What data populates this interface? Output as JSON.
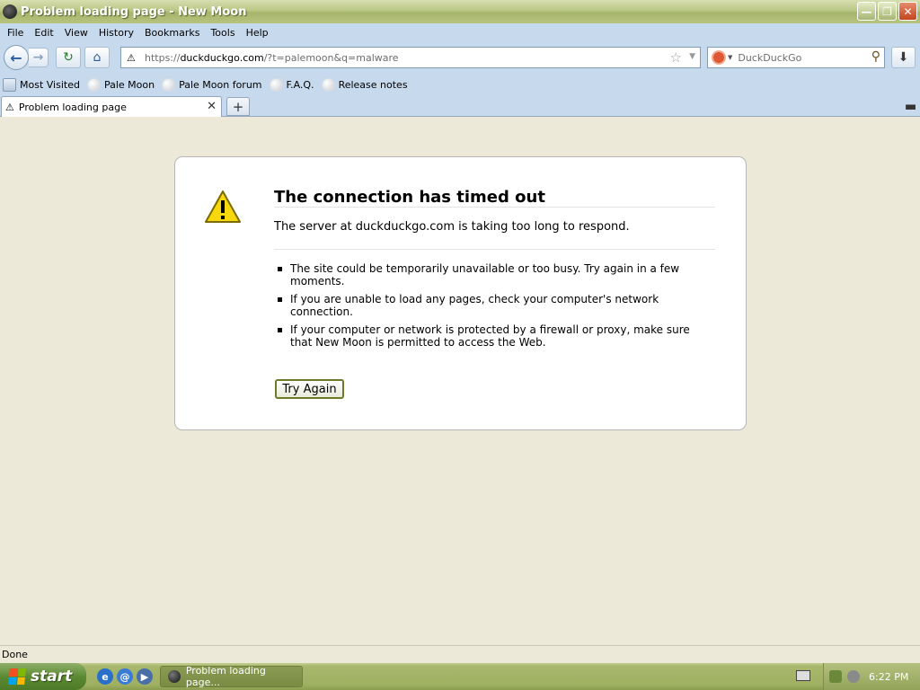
{
  "window": {
    "title": "Problem loading page - New Moon"
  },
  "menu": [
    "File",
    "Edit",
    "View",
    "History",
    "Bookmarks",
    "Tools",
    "Help"
  ],
  "navbar": {
    "url_scheme": "https://",
    "url_host": "duckduckgo.com",
    "url_rest": "/?t=palemoon&q=malware",
    "search_engine": "DuckDuckGo"
  },
  "bookmarks": [
    "Most Visited",
    "Pale Moon",
    "Pale Moon forum",
    "F.A.Q.",
    "Release notes"
  ],
  "tab": {
    "label": "Problem loading page"
  },
  "error": {
    "title": "The connection has timed out",
    "short_desc": "The server at duckduckgo.com is taking too long to respond.",
    "items": [
      "The site could be temporarily unavailable or too busy. Try again in a few moments.",
      "If you are unable to load any pages, check your computer's network connection.",
      "If your computer or network is protected by a firewall or proxy, make sure that New Moon is permitted to access the Web."
    ],
    "retry_label": "Try Again"
  },
  "status": {
    "text": "Done"
  },
  "taskbar": {
    "start_label": "start",
    "task_label": "Problem loading page...",
    "clock": "6:22 PM"
  },
  "colors": {
    "titlebar": "#b9c784",
    "toolbar": "#c7d9ed",
    "content_bg": "#ece9d8",
    "taskbar": "#9fb063"
  }
}
